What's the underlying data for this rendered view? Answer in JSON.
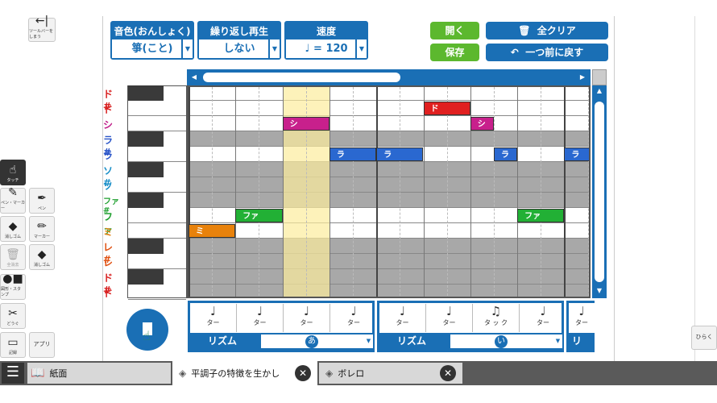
{
  "sidebar": {
    "hide_toolbar": "ツールバーをしまう",
    "touch": "タッチ",
    "pen_marker": "ペン・マーカー",
    "pen": "ペン",
    "eraser": "消しゴム",
    "marker": "マーカー",
    "clear_all": "全消去",
    "eraser2": "消しゴム",
    "shape_stamp": "図形・スタンプ",
    "tools": "どうぐ",
    "record": "記録",
    "apps": "アプリ",
    "open_panel": "ひらく"
  },
  "controls": {
    "tone": {
      "label": "音色(おんしょく)",
      "value": "箏(こと)"
    },
    "repeat": {
      "label": "繰り返し再生",
      "value": "しない"
    },
    "tempo": {
      "label": "速度",
      "value": "= 120"
    },
    "open": "開く",
    "save": "保存",
    "clear_all": "全クリア",
    "undo": "一つ前に戻す"
  },
  "pitches": [
    {
      "label": "ド#",
      "color": "#d82020",
      "shade": false,
      "black": true
    },
    {
      "label": "ド",
      "color": "#d82020",
      "shade": false,
      "black": false
    },
    {
      "label": "シ",
      "color": "#c0208a",
      "shade": false,
      "black": false
    },
    {
      "label": "ラ#",
      "color": "#2a55c8",
      "shade": true,
      "black": true
    },
    {
      "label": "ラ",
      "color": "#2a55c8",
      "shade": false,
      "black": false
    },
    {
      "label": "ソ#",
      "color": "#1a8fc8",
      "shade": true,
      "black": true
    },
    {
      "label": "ソ",
      "color": "#1a8fc8",
      "shade": true,
      "black": false
    },
    {
      "label": "ファ#",
      "color": "#20a030",
      "shade": true,
      "black": true
    },
    {
      "label": "ファ",
      "color": "#20a030",
      "shade": false,
      "black": false
    },
    {
      "label": "ミ",
      "color": "#e08010",
      "shade": false,
      "black": false
    },
    {
      "label": "レ#",
      "color": "#e05010",
      "shade": true,
      "black": true
    },
    {
      "label": "レ",
      "color": "#e05010",
      "shade": true,
      "black": false
    },
    {
      "label": "ド#",
      "color": "#d82020",
      "shade": true,
      "black": true
    },
    {
      "label": "ド",
      "color": "#d82020",
      "shade": true,
      "black": false
    }
  ],
  "notes": [
    {
      "row": 9,
      "col": 0,
      "span": 1,
      "label": "ミ",
      "color": "#e8820c"
    },
    {
      "row": 8,
      "col": 1,
      "span": 1,
      "label": "ファ",
      "color": "#22b035"
    },
    {
      "row": 2,
      "col": 2,
      "span": 1,
      "label": "シ",
      "color": "#c8208c"
    },
    {
      "row": 4,
      "col": 3,
      "span": 1,
      "label": "ラ",
      "color": "#2a68d0"
    },
    {
      "row": 4,
      "col": 4,
      "span": 1,
      "label": "ラ",
      "color": "#2a68d0"
    },
    {
      "row": 1,
      "col": 5,
      "span": 1,
      "label": "ド",
      "color": "#e02020"
    },
    {
      "row": 2,
      "col": 6,
      "span": 0.5,
      "label": "シ",
      "color": "#c8208c"
    },
    {
      "row": 4,
      "col": 6.5,
      "span": 0.5,
      "label": "ラ",
      "color": "#2a68d0"
    },
    {
      "row": 8,
      "col": 7,
      "span": 1,
      "label": "ファ",
      "color": "#22b035"
    },
    {
      "row": 4,
      "col": 8,
      "span": 0.55,
      "label": "ラ",
      "color": "#2a68d0"
    }
  ],
  "rhythm": {
    "cells": [
      "ター",
      "ター",
      "ター",
      "ター",
      "ター",
      "ター",
      "タ ッ ク",
      "ター",
      "ター"
    ],
    "panels": [
      {
        "label": "リズム",
        "value": "あ"
      },
      {
        "label": "リズム",
        "value": "い"
      },
      {
        "label": "リ",
        "value": ""
      }
    ]
  },
  "tabs": [
    {
      "label": "紙面"
    },
    {
      "label": "平調子の特徴を生かし"
    },
    {
      "label": "ボレロ"
    }
  ],
  "colors": {
    "accent": "#1a6fb5",
    "green": "#5cb82e",
    "highlight": "#fcec9c"
  }
}
